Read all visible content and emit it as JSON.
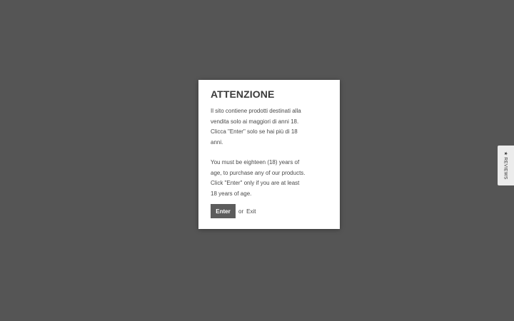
{
  "age_gate": {
    "title": "ATTENZIONE",
    "text_it": "Il sito contiene prodotti destinati alla vendita solo ai maggiori di anni 18. Clicca \"Enter\" solo se hai più di 18 anni.",
    "text_en": "You must be eighteen (18) years of age, to purchase any of our products. Click \"Enter\" only if you are at least 18 years of age.",
    "enter_label": "Enter",
    "or_label": "or",
    "exit_label": "Exit"
  },
  "reviews_tab": {
    "icon": "★",
    "label": "REVIEWS"
  },
  "colors": {
    "overlay": "#555555",
    "modal_bg": "#ffffff",
    "button_bg": "#5c5c5c",
    "tab_bg": "#ececec"
  }
}
